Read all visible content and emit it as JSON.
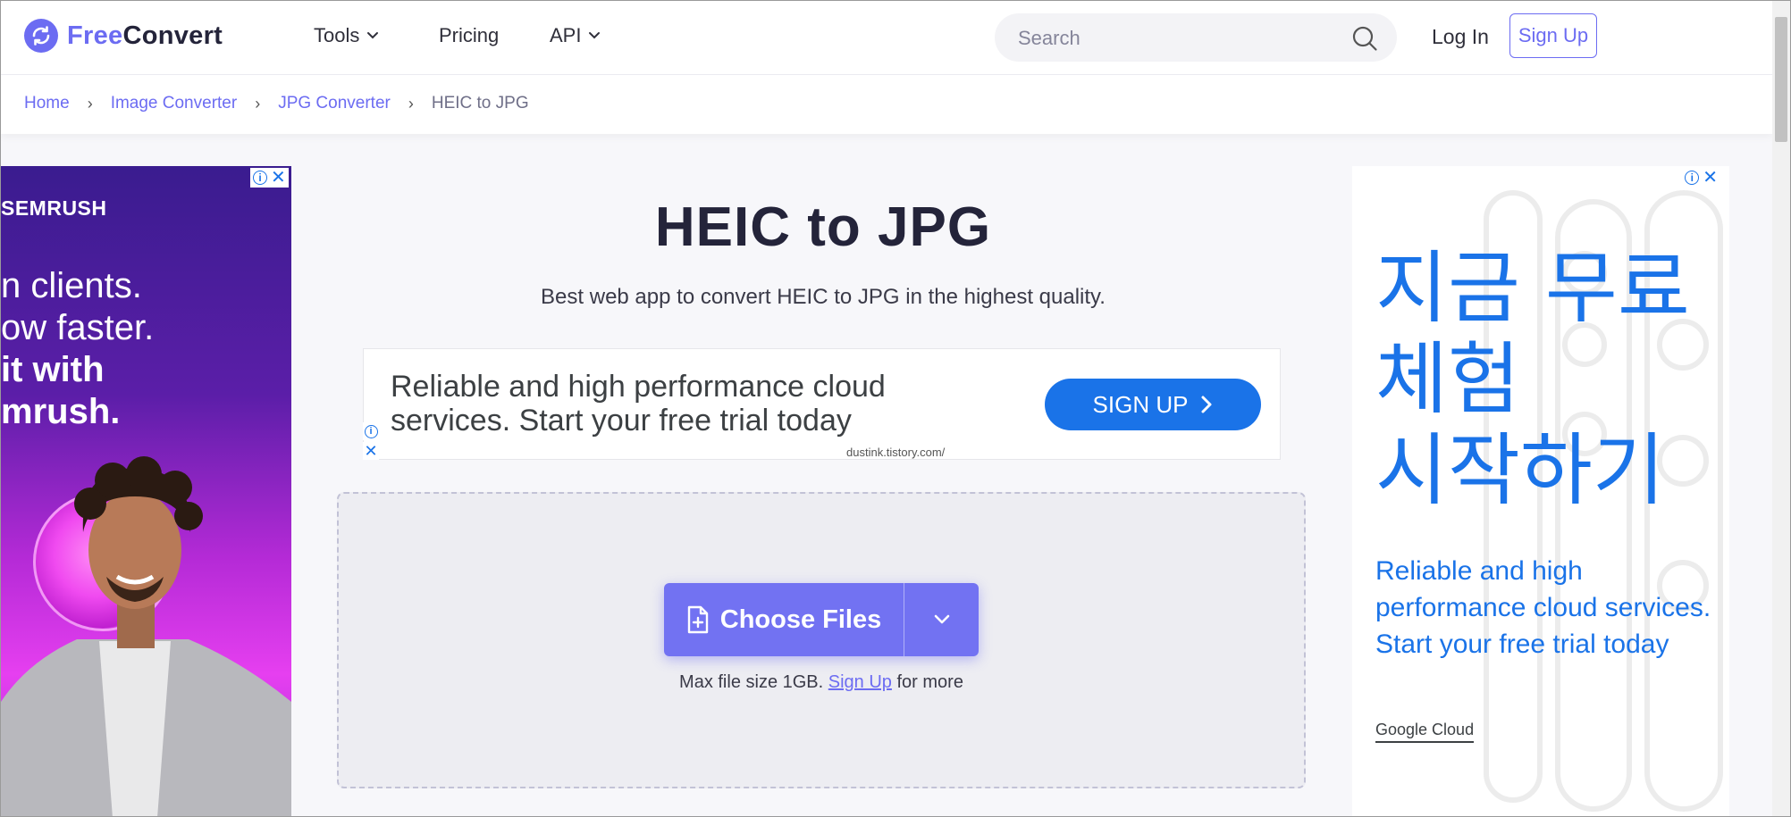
{
  "brand": {
    "free": "Free",
    "convert": "Convert"
  },
  "nav": {
    "tools": "Tools",
    "pricing": "Pricing",
    "api": "API"
  },
  "search": {
    "placeholder": "Search"
  },
  "auth": {
    "login": "Log In",
    "signup": "Sign Up"
  },
  "breadcrumb": {
    "home": "Home",
    "image_converter": "Image Converter",
    "jpg_converter": "JPG Converter",
    "current": "HEIC to JPG"
  },
  "page": {
    "title": "HEIC to JPG",
    "subtitle": "Best web app to convert HEIC to JPG in the highest quality."
  },
  "banner_ad": {
    "text": "Reliable and high performance cloud services. Start your free trial today",
    "button": "SIGN UP",
    "url": "dustink.tistory.com/"
  },
  "uploader": {
    "choose_label": "Choose Files",
    "max_prefix": "Max file size 1GB.",
    "max_link": "Sign Up",
    "max_suffix": "for more"
  },
  "left_ad": {
    "brand": "SEMRUSH",
    "line1": "n clients.",
    "line2": "ow faster.",
    "line3": "it with",
    "line4": "mrush."
  },
  "right_ad": {
    "kr1": "지금 무료",
    "kr2": "체험",
    "kr3": "시작하기",
    "text": "Reliable and high performance cloud services. Start your free trial today",
    "brand": "Google Cloud"
  },
  "colors": {
    "accent": "#6c6cf2",
    "google_blue": "#1a73e8"
  }
}
